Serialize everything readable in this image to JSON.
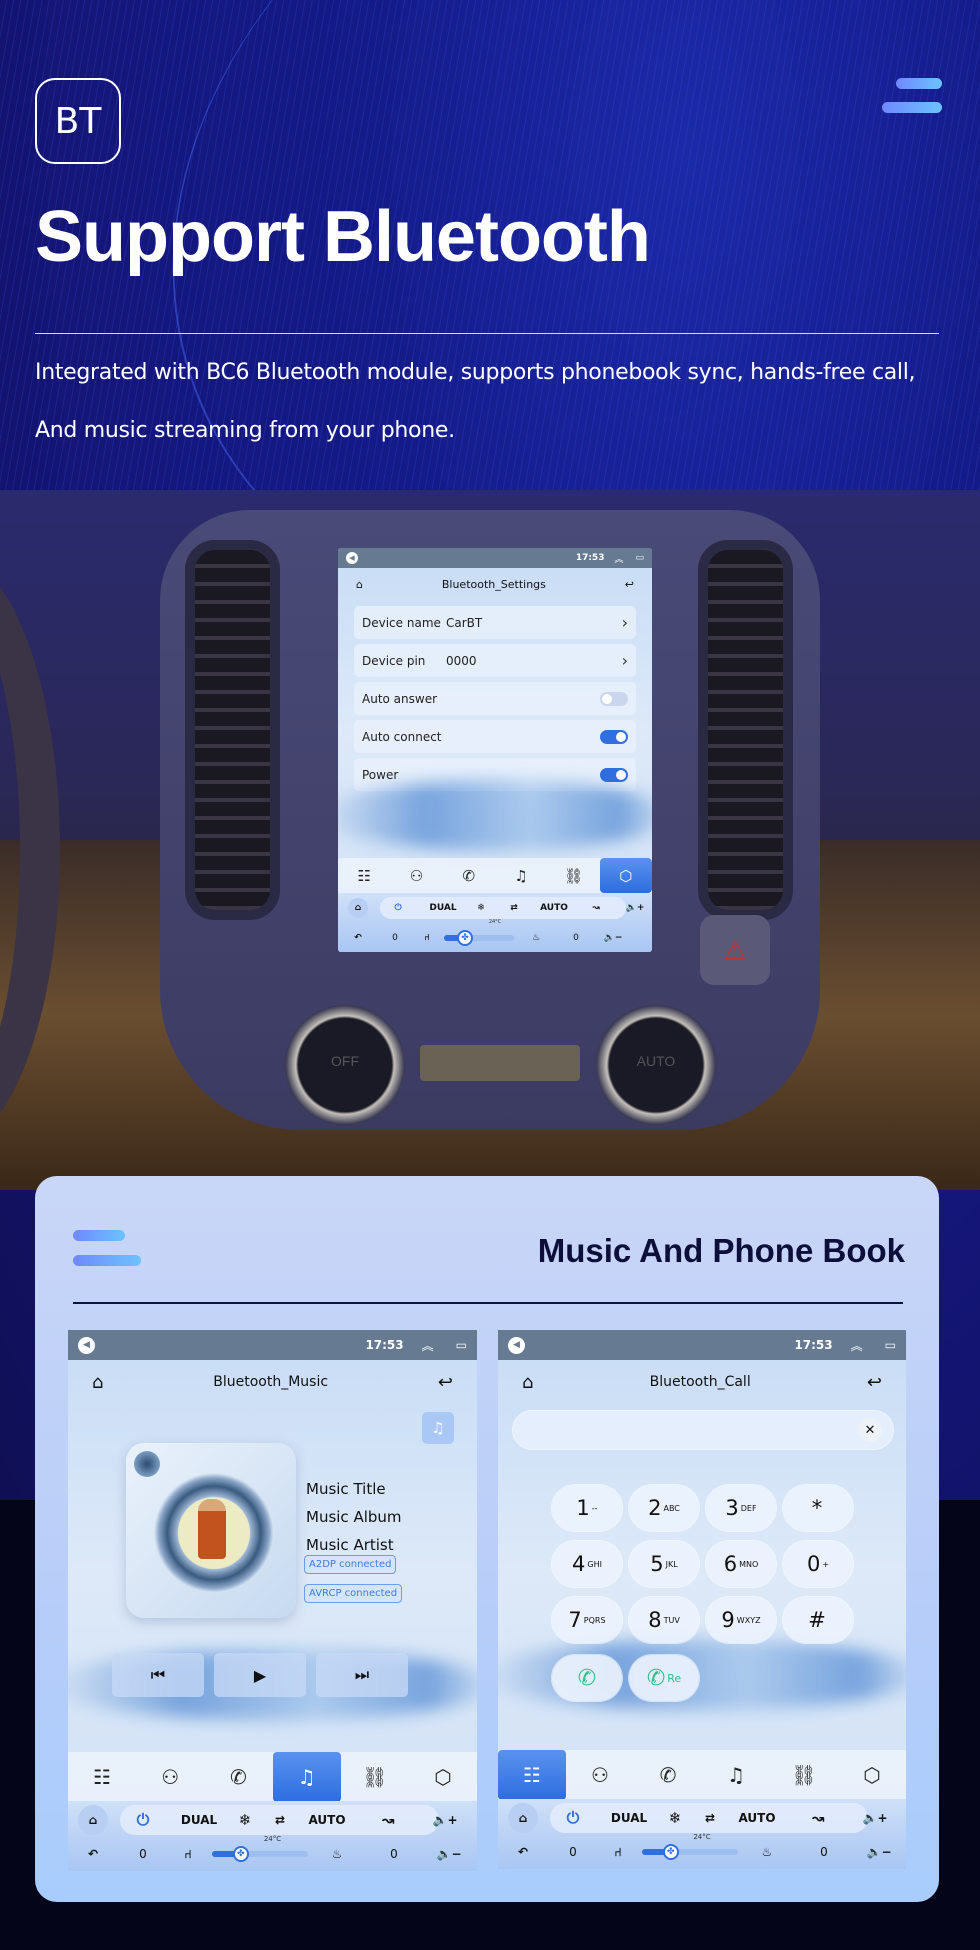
{
  "hero": {
    "badge": "BT",
    "title": "Support Bluetooth",
    "desc_line1": "Integrated with BC6 Bluetooth module, supports phonebook sync, hands-free call,",
    "desc_line2": "And music streaming from your phone."
  },
  "status_bar": {
    "time": "17:53"
  },
  "settings_screen": {
    "title": "Bluetooth_Settings",
    "rows": [
      {
        "label": "Device name",
        "value": "CarBT",
        "type": "link"
      },
      {
        "label": "Device pin",
        "value": "0000",
        "type": "link"
      },
      {
        "label": "Auto answer",
        "type": "toggle",
        "on": false
      },
      {
        "label": "Auto connect",
        "type": "toggle",
        "on": true
      },
      {
        "label": "Power",
        "type": "toggle",
        "on": true
      }
    ]
  },
  "dock": {
    "items": [
      {
        "name": "apps-grid-icon",
        "glyph": "☷"
      },
      {
        "name": "contacts-icon",
        "glyph": "⚇"
      },
      {
        "name": "phone-icon",
        "glyph": "✆"
      },
      {
        "name": "music-icon",
        "glyph": "♫"
      },
      {
        "name": "link-icon",
        "glyph": "⛓"
      },
      {
        "name": "settings-icon",
        "glyph": "⬡"
      }
    ]
  },
  "climate": {
    "dual": "DUAL",
    "auto": "AUTO",
    "temp": "24°C",
    "left_seat": "0",
    "right_seat": "0",
    "fan_level": 0.3
  },
  "car_labels": {
    "knob_left": "OFF",
    "knob_right": "AUTO"
  },
  "card": {
    "title": "Music And Phone Book"
  },
  "music_screen": {
    "title": "Bluetooth_Music",
    "track_title": "Music Title",
    "track_album": "Music Album",
    "track_artist": "Music Artist",
    "a2dp": "A2DP  connected",
    "avrcp": "AVRCP connected",
    "prev": "⏮",
    "play": "▶",
    "next": "⏭"
  },
  "call_screen": {
    "title": "Bluetooth_Call",
    "number_input": "",
    "keys": [
      {
        "d": "1",
        "s": "--"
      },
      {
        "d": "2",
        "s": "ABC"
      },
      {
        "d": "3",
        "s": "DEF"
      },
      {
        "d": "*",
        "s": ""
      },
      {
        "d": "4",
        "s": "GHI"
      },
      {
        "d": "5",
        "s": "JKL"
      },
      {
        "d": "6",
        "s": "MNO"
      },
      {
        "d": "0",
        "s": "+"
      },
      {
        "d": "7",
        "s": "PQRS"
      },
      {
        "d": "8",
        "s": "TUV"
      },
      {
        "d": "9",
        "s": "WXYZ"
      },
      {
        "d": "#",
        "s": ""
      }
    ],
    "redial": "Re"
  },
  "colors": {
    "accent": "#2f6fe0",
    "call_green": "#2ec088",
    "status_bar": "#667a92"
  }
}
